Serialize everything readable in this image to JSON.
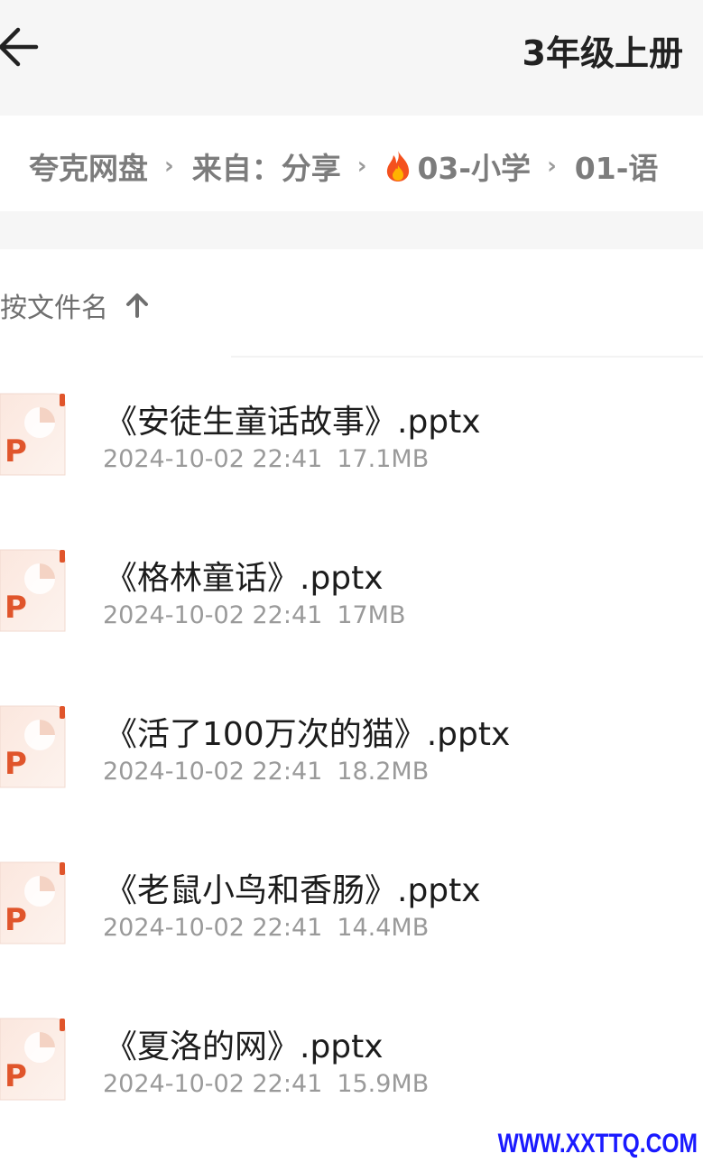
{
  "header": {
    "back_icon": "arrow-left-icon",
    "title": "3年级上册"
  },
  "breadcrumb": {
    "items": [
      "夸克网盘",
      "来自：分享",
      "03-小学",
      "01-语"
    ],
    "separator_icon": "chevron-right-icon",
    "fire_icon": "fire-emoji-icon"
  },
  "sort": {
    "label": "按文件名",
    "direction_icon": "arrow-up-icon"
  },
  "files": [
    {
      "name": "《安徒生童话故事》.pptx",
      "date": "2024-10-02 22:41",
      "size": "17.1MB",
      "icon": "pptx-file-icon"
    },
    {
      "name": "《格林童话》.pptx",
      "date": "2024-10-02 22:41",
      "size": "17MB",
      "icon": "pptx-file-icon"
    },
    {
      "name": "《活了100万次的猫》.pptx",
      "date": "2024-10-02 22:41",
      "size": "18.2MB",
      "icon": "pptx-file-icon"
    },
    {
      "name": "《老鼠小鸟和香肠》.pptx",
      "date": "2024-10-02 22:41",
      "size": "14.4MB",
      "icon": "pptx-file-icon"
    },
    {
      "name": "《夏洛的网》.pptx",
      "date": "2024-10-02 22:41",
      "size": "15.9MB",
      "icon": "pptx-file-icon"
    }
  ],
  "watermark": "WWW.XXTTQ.COM",
  "colors": {
    "accent_ppt": "#e0552b",
    "watermark": "#1a1aff"
  }
}
